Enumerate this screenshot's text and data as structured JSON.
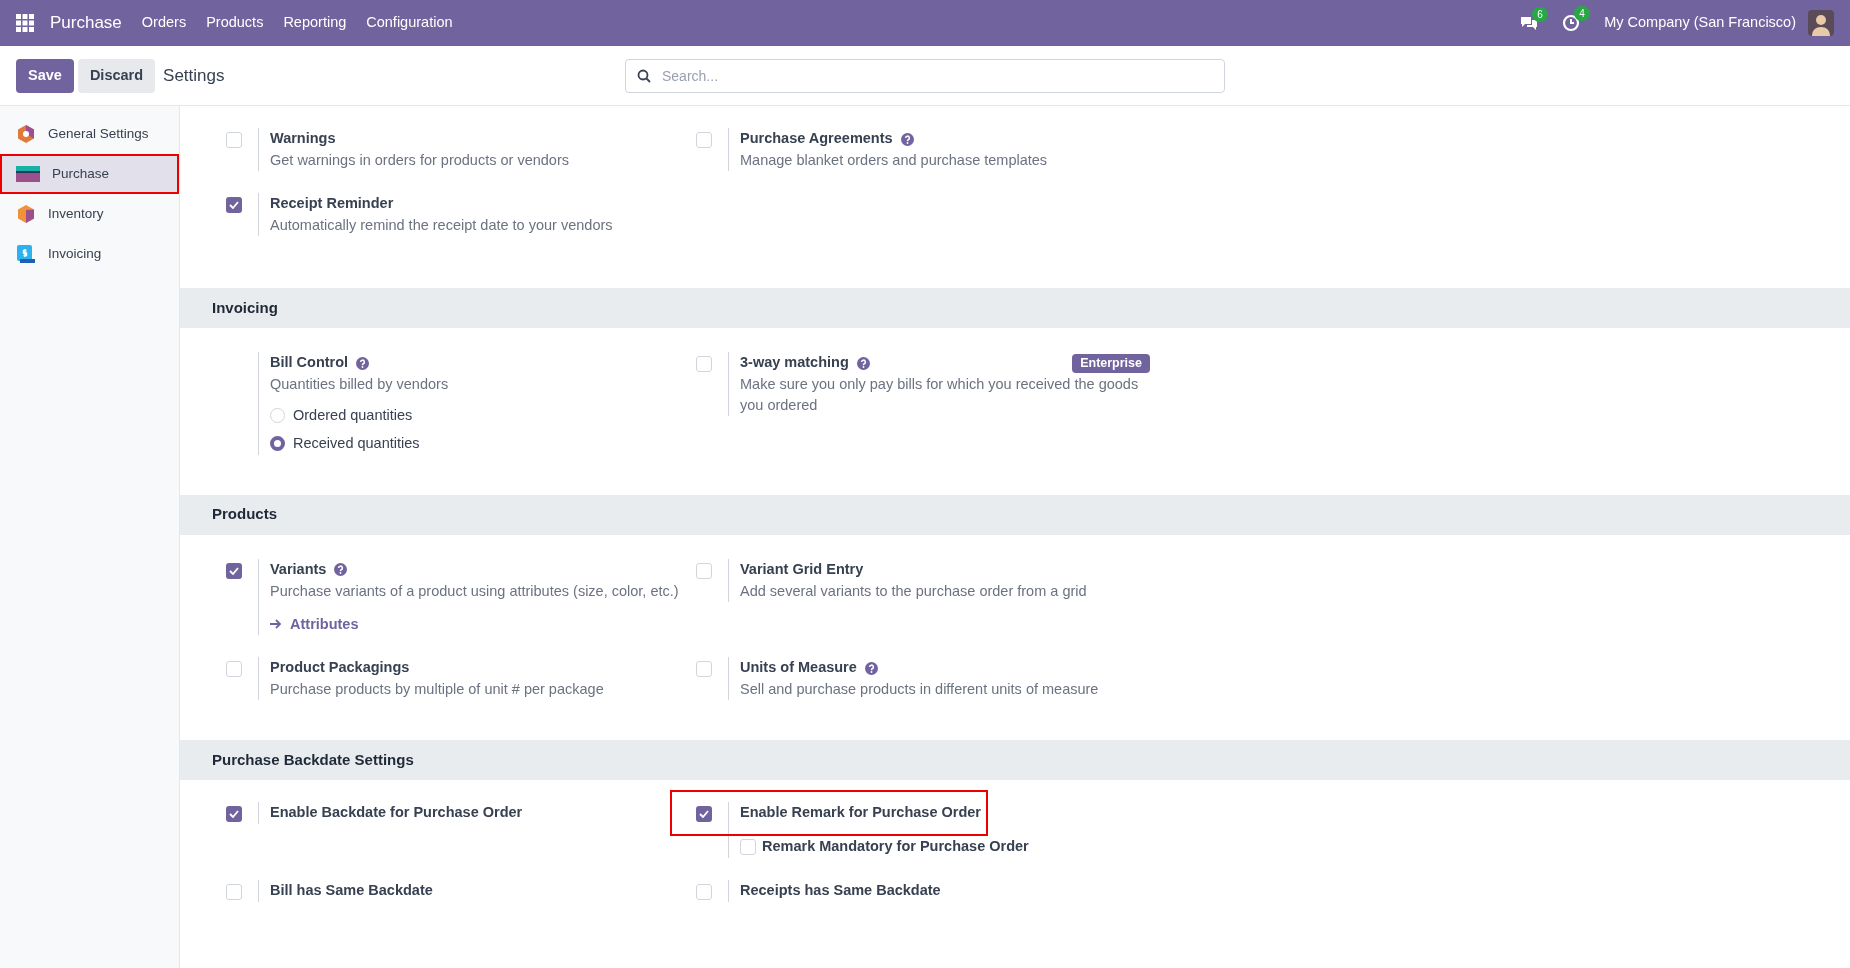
{
  "topbar": {
    "app": "Purchase",
    "menu": [
      "Orders",
      "Products",
      "Reporting",
      "Configuration"
    ],
    "messages_count": "6",
    "activities_count": "4",
    "company": "My Company (San Francisco)"
  },
  "control_bar": {
    "save": "Save",
    "discard": "Discard",
    "title": "Settings",
    "search": {
      "placeholder": "Search..."
    }
  },
  "sidebar": {
    "items": [
      {
        "label": "General Settings",
        "kind": "general",
        "selected": false,
        "highlighted": false
      },
      {
        "label": "Purchase",
        "kind": "purchase",
        "selected": true,
        "highlighted": true
      },
      {
        "label": "Inventory",
        "kind": "inventory",
        "selected": false,
        "highlighted": false
      },
      {
        "label": "Invoicing",
        "kind": "invoicing",
        "selected": false,
        "highlighted": false
      }
    ]
  },
  "sections": [
    {
      "settings": [
        {
          "kind": "checkbox",
          "label": "Warnings",
          "checked": false,
          "help": false,
          "description": "Get warnings in orders for products or vendors"
        },
        {
          "kind": "checkbox",
          "label": "Purchase Agreements",
          "checked": false,
          "help": true,
          "description": "Manage blanket orders and purchase templates"
        },
        {
          "kind": "checkbox",
          "label": "Receipt Reminder",
          "checked": true,
          "help": false,
          "description": "Automatically remind the receipt date to your vendors"
        }
      ]
    },
    {
      "title": "Invoicing",
      "settings": [
        {
          "kind": "radio",
          "label": "Bill Control",
          "help": true,
          "description": "Quantities billed by vendors",
          "options": [
            {
              "label": "Ordered quantities",
              "selected": false
            },
            {
              "label": "Received quantities",
              "selected": true
            }
          ]
        },
        {
          "kind": "checkbox",
          "label": "3-way matching",
          "checked": false,
          "help": true,
          "badge": "Enterprise",
          "description": "Make sure you only pay bills for which you received the goods you ordered"
        }
      ]
    },
    {
      "title": "Products",
      "settings": [
        {
          "kind": "checkbox",
          "label": "Variants",
          "checked": true,
          "help": true,
          "description": "Purchase variants of a product using attributes (size, color, etc.)",
          "link": "Attributes"
        },
        {
          "kind": "checkbox",
          "label": "Variant Grid Entry",
          "checked": false,
          "help": false,
          "description": "Add several variants to the purchase order from a grid"
        },
        {
          "kind": "checkbox",
          "label": "Product Packagings",
          "checked": false,
          "help": false,
          "description": "Purchase products by multiple of unit # per package"
        },
        {
          "kind": "checkbox",
          "label": "Units of Measure",
          "checked": false,
          "help": true,
          "description": "Sell and purchase products in different units of measure"
        }
      ]
    },
    {
      "title": "Purchase Backdate Settings",
      "settings": [
        {
          "kind": "checkbox",
          "label": "Enable Backdate for Purchase Order",
          "checked": true,
          "help": false
        },
        {
          "kind": "checkbox",
          "label": "Enable Remark for Purchase Order",
          "checked": true,
          "help": false,
          "highlighted": true,
          "sub_option": {
            "label": "Remark Mandatory for Purchase Order",
            "checked": false
          }
        },
        {
          "kind": "checkbox",
          "label": "Bill has Same Backdate",
          "checked": false,
          "help": false
        },
        {
          "kind": "checkbox",
          "label": "Receipts has Same Backdate",
          "checked": false,
          "help": false
        }
      ]
    }
  ]
}
